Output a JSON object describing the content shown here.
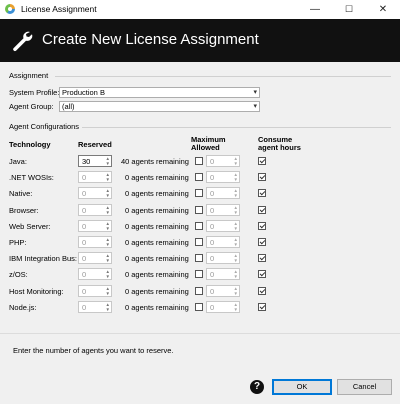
{
  "window": {
    "title": "License Assignment",
    "minimize": "—",
    "maximize": "☐",
    "close": "✕"
  },
  "banner": {
    "title": "Create New License Assignment",
    "icon": "wrench-icon"
  },
  "assignment": {
    "group_label": "Assignment",
    "system_profile": {
      "label": "System Profile:",
      "value": "Production B"
    },
    "agent_group": {
      "label": "Agent Group:",
      "value": "(all)"
    }
  },
  "agent_config": {
    "group_label": "Agent Configurations",
    "headers": {
      "technology": "Technology",
      "reserved": "Reserved",
      "maximum": "Maximum",
      "allowed": "Allowed",
      "consume": "Consume",
      "agent_hours": "agent hours"
    },
    "rows": [
      {
        "tech": "Java:",
        "reserved": "30",
        "remaining": "40 agents remaining",
        "max_checked": false,
        "max_value": "0",
        "consume": true,
        "active": true
      },
      {
        "tech": ".NET WOSIs:",
        "reserved": "0",
        "remaining": "0 agents remaining",
        "max_checked": false,
        "max_value": "0",
        "consume": true,
        "active": false
      },
      {
        "tech": "Native:",
        "reserved": "0",
        "remaining": "0 agents remaining",
        "max_checked": false,
        "max_value": "0",
        "consume": true,
        "active": false
      },
      {
        "tech": "Browser:",
        "reserved": "0",
        "remaining": "0 agents remaining",
        "max_checked": false,
        "max_value": "0",
        "consume": true,
        "active": false
      },
      {
        "tech": "Web Server:",
        "reserved": "0",
        "remaining": "0 agents remaining",
        "max_checked": false,
        "max_value": "0",
        "consume": true,
        "active": false
      },
      {
        "tech": "PHP:",
        "reserved": "0",
        "remaining": "0 agents remaining",
        "max_checked": false,
        "max_value": "0",
        "consume": true,
        "active": false
      },
      {
        "tech": "IBM Integration Bus:",
        "reserved": "0",
        "remaining": "0 agents remaining",
        "max_checked": false,
        "max_value": "0",
        "consume": true,
        "active": false
      },
      {
        "tech": "z/OS:",
        "reserved": "0",
        "remaining": "0 agents remaining",
        "max_checked": false,
        "max_value": "0",
        "consume": true,
        "active": false
      },
      {
        "tech": "Host Monitoring:",
        "reserved": "0",
        "remaining": "0 agents remaining",
        "max_checked": false,
        "max_value": "0",
        "consume": true,
        "active": false
      },
      {
        "tech": "Node.js:",
        "reserved": "0",
        "remaining": "0 agents remaining",
        "max_checked": false,
        "max_value": "0",
        "consume": true,
        "active": false
      }
    ]
  },
  "footer": {
    "hint": "Enter the number of agents you want to reserve.",
    "help_icon": "help-icon",
    "help_glyph": "?",
    "ok_label": "OK",
    "cancel_label": "Cancel"
  }
}
